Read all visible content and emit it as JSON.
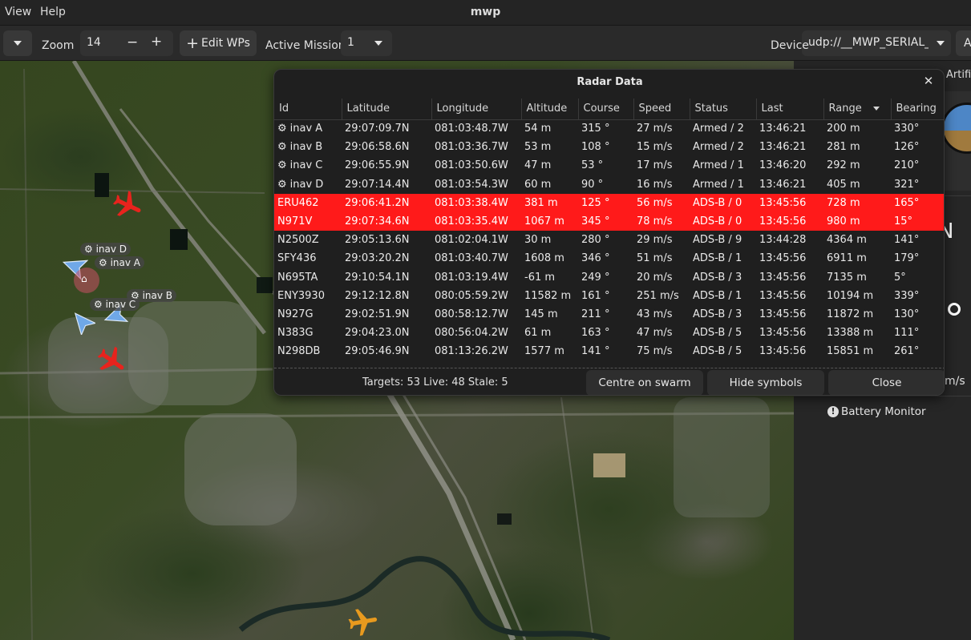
{
  "menu": {
    "view": "View",
    "help": "Help"
  },
  "app_title": "mwp",
  "toolbar": {
    "zoom_label": "Zoom",
    "zoom_value": "14",
    "zoom_out": "−",
    "zoom_in": "+",
    "edit_wps_label": "Edit WPs",
    "active_mission_label": "Active Mission",
    "active_mission_value": "1",
    "device_label": "Device",
    "device_value": "udp://__MWP_SERIAL_H",
    "overflow_label": "A"
  },
  "map": {
    "labels": [
      "inav D",
      "inav A",
      "inav B",
      "inav C"
    ]
  },
  "side_panel": {
    "artificial_horizon_label": "Artificial",
    "compass_letter": "N",
    "speed_unit": "m/s",
    "battery_monitor_label": "Battery Monitor"
  },
  "radar": {
    "title": "Radar Data",
    "columns": [
      "Id",
      "Latitude",
      "Longitude",
      "Altitude",
      "Course",
      "Speed",
      "Status",
      "Last",
      "Range",
      "Bearing"
    ],
    "rows": [
      {
        "icon": "⚙",
        "id": "inav A",
        "lat": "29:07:09.7N",
        "lon": "081:03:48.7W",
        "alt": "54 m",
        "course": "315 °",
        "speed": "27 m/s",
        "status": "Armed / 2",
        "last": "13:46:21",
        "range": "200 m",
        "bearing": "330°",
        "highlight": false
      },
      {
        "icon": "⚙",
        "id": "inav B",
        "lat": "29:06:58.6N",
        "lon": "081:03:36.7W",
        "alt": "53 m",
        "course": "108 °",
        "speed": "15 m/s",
        "status": "Armed / 2",
        "last": "13:46:21",
        "range": "281 m",
        "bearing": "126°",
        "highlight": false
      },
      {
        "icon": "⚙",
        "id": "inav C",
        "lat": "29:06:55.9N",
        "lon": "081:03:50.6W",
        "alt": "47 m",
        "course": "53 °",
        "speed": "17 m/s",
        "status": "Armed / 1",
        "last": "13:46:20",
        "range": "292 m",
        "bearing": "210°",
        "highlight": false
      },
      {
        "icon": "⚙",
        "id": "inav D",
        "lat": "29:07:14.4N",
        "lon": "081:03:54.3W",
        "alt": "60 m",
        "course": "90 °",
        "speed": "16 m/s",
        "status": "Armed / 1",
        "last": "13:46:21",
        "range": "405 m",
        "bearing": "321°",
        "highlight": false
      },
      {
        "icon": "",
        "id": "ERU462",
        "lat": "29:06:41.2N",
        "lon": "081:03:38.4W",
        "alt": "381 m",
        "course": "125 °",
        "speed": "56 m/s",
        "status": "ADS-B / 0",
        "last": "13:45:56",
        "range": "728 m",
        "bearing": "165°",
        "highlight": true
      },
      {
        "icon": "",
        "id": "N971V",
        "lat": "29:07:34.6N",
        "lon": "081:03:35.4W",
        "alt": "1067 m",
        "course": "345 °",
        "speed": "78 m/s",
        "status": "ADS-B / 0",
        "last": "13:45:56",
        "range": "980 m",
        "bearing": "15°",
        "highlight": true
      },
      {
        "icon": "",
        "id": "N2500Z",
        "lat": "29:05:13.6N",
        "lon": "081:02:04.1W",
        "alt": "30 m",
        "course": "280 °",
        "speed": "29 m/s",
        "status": "ADS-B / 9",
        "last": "13:44:28",
        "range": "4364 m",
        "bearing": "141°",
        "highlight": false
      },
      {
        "icon": "",
        "id": "SFY436",
        "lat": "29:03:20.2N",
        "lon": "081:03:40.7W",
        "alt": "1608 m",
        "course": "346 °",
        "speed": "51 m/s",
        "status": "ADS-B / 1",
        "last": "13:45:56",
        "range": "6911 m",
        "bearing": "179°",
        "highlight": false
      },
      {
        "icon": "",
        "id": "N695TA",
        "lat": "29:10:54.1N",
        "lon": "081:03:19.4W",
        "alt": "-61 m",
        "course": "249 °",
        "speed": "20 m/s",
        "status": "ADS-B / 3",
        "last": "13:45:56",
        "range": "7135 m",
        "bearing": "5°",
        "highlight": false
      },
      {
        "icon": "",
        "id": "ENY3930",
        "lat": "29:12:12.8N",
        "lon": "080:05:59.2W",
        "alt": "11582 m",
        "course": "161 °",
        "speed": "251 m/s",
        "status": "ADS-B / 1",
        "last": "13:45:56",
        "range": "10194 m",
        "bearing": "339°",
        "highlight": false
      },
      {
        "icon": "",
        "id": "N927G",
        "lat": "29:02:51.9N",
        "lon": "080:58:12.7W",
        "alt": "145 m",
        "course": "211 °",
        "speed": "43 m/s",
        "status": "ADS-B / 3",
        "last": "13:45:56",
        "range": "11872 m",
        "bearing": "130°",
        "highlight": false
      },
      {
        "icon": "",
        "id": "N383G",
        "lat": "29:04:23.0N",
        "lon": "080:56:04.2W",
        "alt": "61 m",
        "course": "163 °",
        "speed": "47 m/s",
        "status": "ADS-B / 5",
        "last": "13:45:56",
        "range": "13388 m",
        "bearing": "111°",
        "highlight": false
      },
      {
        "icon": "",
        "id": "N298DB",
        "lat": "29:05:46.9N",
        "lon": "081:13:26.2W",
        "alt": "1577 m",
        "course": "141 °",
        "speed": "75 m/s",
        "status": "ADS-B / 5",
        "last": "13:45:56",
        "range": "15851 m",
        "bearing": "261°",
        "highlight": false
      }
    ],
    "status_text": "Targets: 53 Live: 48 Stale: 5",
    "centre_button": "Centre on swarm",
    "hide_button": "Hide symbols",
    "close_button": "Close",
    "highlight_color": "#ff1a1a"
  },
  "colors": {
    "aircraft_adsb": "#e8231d",
    "aircraft_other": "#e89a1e",
    "inav_marker": "#6fa8e8"
  }
}
